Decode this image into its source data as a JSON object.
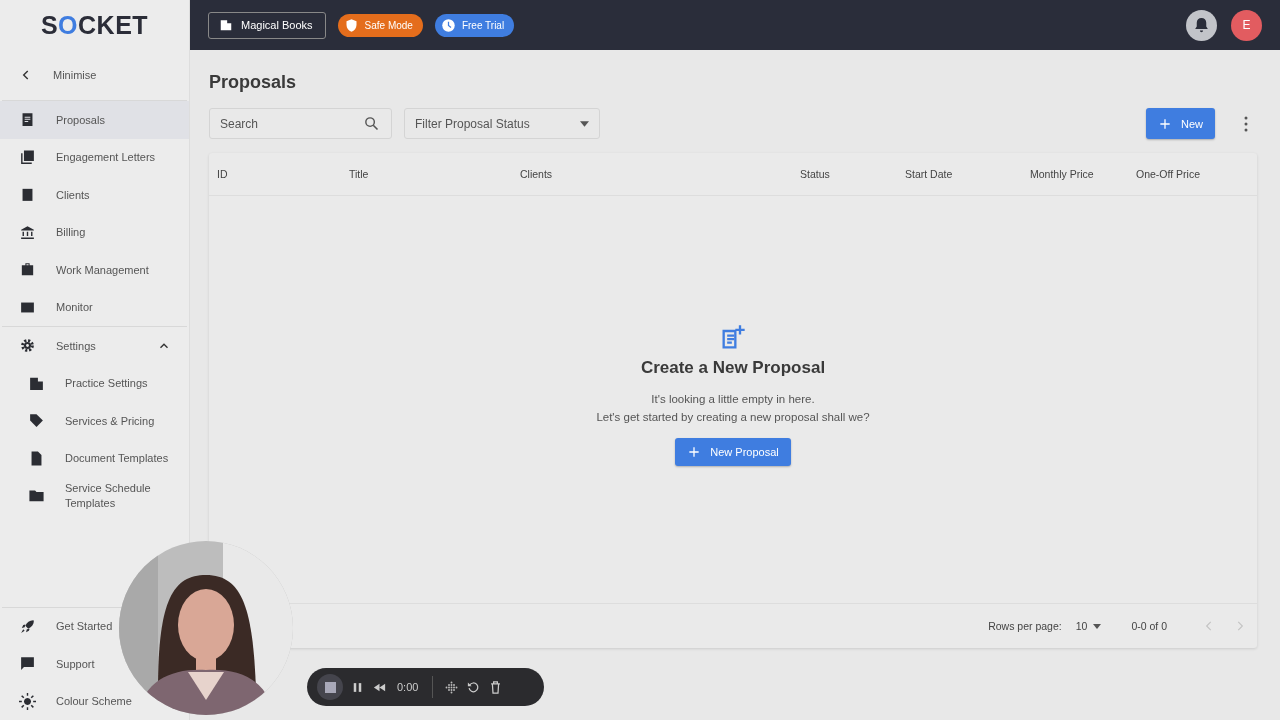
{
  "sidebar": {
    "logo": "SOCKET",
    "minimise": "Minimise",
    "items": [
      {
        "label": "Proposals",
        "selected": true
      },
      {
        "label": "Engagement Letters",
        "selected": false
      },
      {
        "label": "Clients",
        "selected": false
      },
      {
        "label": "Billing",
        "selected": false
      },
      {
        "label": "Work Management",
        "selected": false
      },
      {
        "label": "Monitor",
        "selected": false
      }
    ],
    "settings": {
      "label": "Settings",
      "expanded": true,
      "children": [
        {
          "label": "Practice Settings",
          "selected": false
        },
        {
          "label": "Services & Pricing",
          "selected": false
        },
        {
          "label": "Document Templates",
          "selected": false
        },
        {
          "label": "Service Schedule Templates",
          "selected": false
        }
      ]
    },
    "bottom": [
      {
        "label": "Get Started"
      },
      {
        "label": "Support"
      },
      {
        "label": "Colour Scheme"
      }
    ]
  },
  "topbar": {
    "practice": "Magical Books",
    "badges": [
      {
        "label": "Safe Mode",
        "color": "#e46d1c"
      },
      {
        "label": "Free Trial",
        "color": "#3f7de0"
      }
    ],
    "avatar": "E"
  },
  "page": {
    "title": "Proposals",
    "search": {
      "placeholder": "Search"
    },
    "filter": {
      "placeholder": "Filter Proposal Status"
    },
    "new_button": "New"
  },
  "table": {
    "columns": [
      "ID",
      "Title",
      "Clients",
      "Status",
      "Start Date",
      "Monthly Price",
      "One-Off Price"
    ]
  },
  "empty": {
    "heading": "Create a New Proposal",
    "lines": [
      "It's looking a little empty in here.",
      "Let's get started by creating a new proposal shall we?"
    ],
    "button": "New Proposal"
  },
  "pagination": {
    "rows_label": "Rows per page:",
    "rows_value": "10",
    "range": "0-0 of 0",
    "prev_disabled": true,
    "next_disabled": true
  },
  "recorder": {
    "time": "0:00"
  }
}
